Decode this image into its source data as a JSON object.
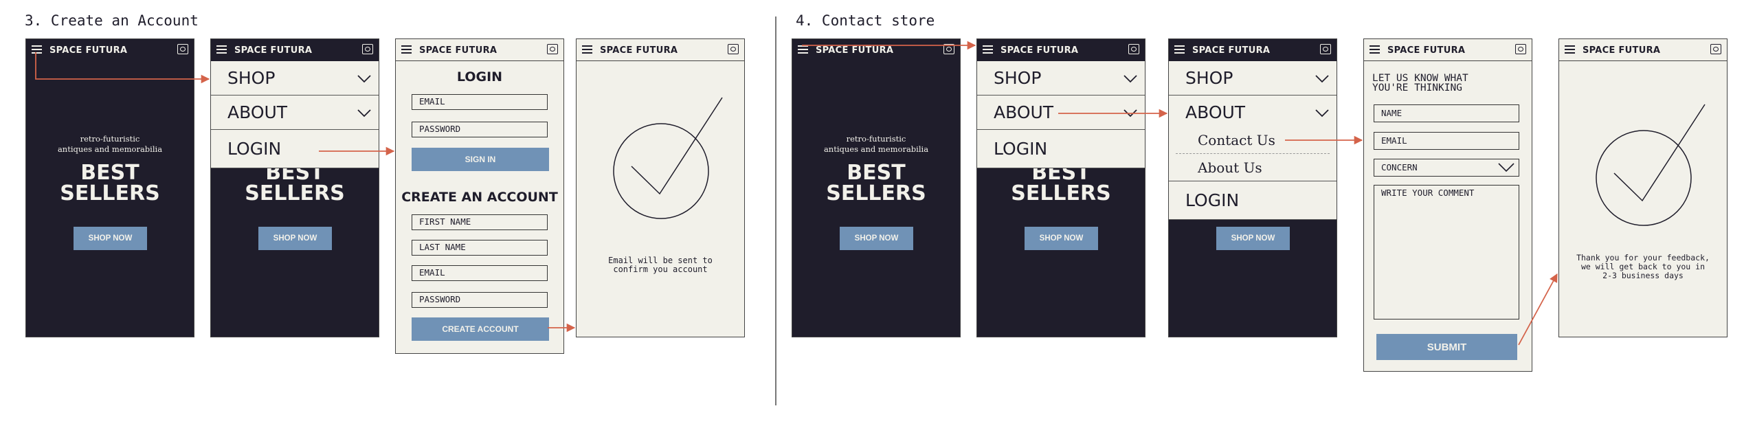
{
  "sections": {
    "create_account": "3. Create an Account",
    "contact_store": "4. Contact store"
  },
  "header": {
    "brand": "SPACE FUTURA"
  },
  "hero": {
    "subtitle": "retro-futuristic\nantiques and memorabilia",
    "title": "BEST\nSELLERS",
    "button": "SHOP NOW"
  },
  "menu": {
    "shop": "SHOP",
    "about": "ABOUT",
    "login": "LOGIN",
    "contact_us": "Contact Us",
    "about_us": "About Us"
  },
  "login_form": {
    "title": "LOGIN",
    "email": "EMAIL",
    "password": "PASSWORD",
    "signin": "SIGN IN"
  },
  "create_form": {
    "title": "CREATE AN ACCOUNT",
    "first_name": "FIRST NAME",
    "last_name": "LAST NAME",
    "email": "EMAIL",
    "password": "PASSWORD",
    "button": "CREATE ACCOUNT"
  },
  "confirm_account": {
    "text": "Email will be sent to\nconfirm you account"
  },
  "contact_form": {
    "heading": "LET US KNOW WHAT\nYOU'RE THINKING",
    "name": "NAME",
    "email": "EMAIL",
    "concern": "CONCERN",
    "comment": "WRITE YOUR COMMENT",
    "submit": "SUBMIT"
  },
  "confirm_feedback": {
    "text": "Thank you for your feedback,\nwe will get back to you in\n2-3 business days"
  },
  "colors": {
    "dark": "#1f1d2b",
    "light": "#f2f1ea",
    "accent": "#7092b6",
    "arrow": "#d4634a"
  }
}
